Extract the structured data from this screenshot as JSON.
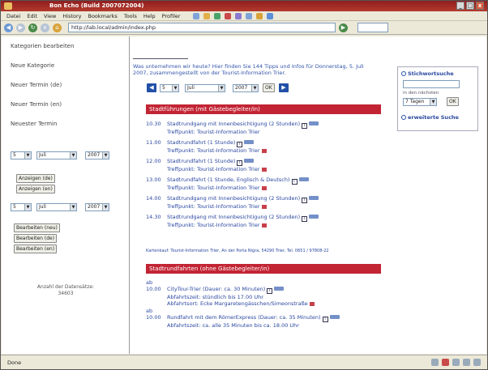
{
  "window": {
    "title": "Bon Echo (Build 2007072004)"
  },
  "menu": [
    "Datei",
    "Edit",
    "View",
    "History",
    "Bookmarks",
    "Tools",
    "Help",
    "Profiler"
  ],
  "toolbar": {
    "url": "http://lab.local/admin/index.php"
  },
  "sidebar": {
    "links": [
      "Kategorien bearbeiten",
      "Neue Kategorie",
      "Neuer Termin (de)",
      "Neuer Termin (en)",
      "Neuester Termin"
    ],
    "form1": {
      "day": "5",
      "month": "Juli",
      "year": "2007"
    },
    "buttons1": [
      "Anzeigen (de)",
      "Anzeigen (en)"
    ],
    "form2": {
      "day": "5",
      "month": "Juli",
      "year": "2007"
    },
    "buttons2": [
      "Bearbeiten (neu)",
      "Bearbeiten (de)",
      "Bearbeiten (en)"
    ],
    "counter_label": "Anzahl der Datensätze:",
    "counter_value": "34603"
  },
  "main": {
    "intro": "Was unternehmen wir heute? Hier finden Sie 144 Tipps und Infos für Donnerstag, 5. Juli 2007, zusammengestellt von der Tourist-Information Trier.",
    "nav": {
      "day": "5",
      "month": "Juli",
      "year": "2007",
      "ok": "OK"
    },
    "section1": "Stadtführungen (mit Gästebegleiter/in)",
    "entries1": [
      {
        "time": "10.30",
        "title": "Stadtrundgang mit Innenbesichtigung (2 Stunden)",
        "sub": "Treffpunkt: Tourist-Information Trier"
      },
      {
        "time": "11.00",
        "title": "Stadtrundfahrt (1 Stunde)",
        "sub": "Treffpunkt: Tourist-Information Trier"
      },
      {
        "time": "12.00",
        "title": "Stadtrundfahrt (1 Stunde)",
        "sub": "Treffpunkt: Tourist-Information Trier"
      },
      {
        "time": "13.00",
        "title": "Stadtrundfahrt (1 Stunde, Englisch & Deutsch)",
        "sub": "Treffpunkt: Tourist-Information Trier"
      },
      {
        "time": "14.00",
        "title": "Stadtrundgang mit Innenbesichtigung (2 Stunden)",
        "sub": "Treffpunkt: Tourist-Information Trier"
      },
      {
        "time": "14.30",
        "title": "Stadtrundgang mit Innenbesichtigung (2 Stunden)",
        "sub": "Treffpunkt: Tourist-Information Trier"
      }
    ],
    "footnote": "Kartenkauf: Tourist-Information Trier, An der Porta Nigra, 54290 Trier, Tel. 0651 / 97808-22",
    "section2": "Stadtrundfahrten (ohne Gästebegleiter/in)",
    "entries2": [
      {
        "time": "ab 10.00",
        "title": "CityTour-Trier (Dauer: ca. 30 Minuten)",
        "sub1": "Abfahrtszeit: stündlich bis 17.00 Uhr",
        "sub2": "Abfahrtsort: Ecke Margaretengässchen/Simeonstraße"
      },
      {
        "time": "ab 10.00",
        "title": "Rundfahrt mit dem RömerExpress (Dauer: ca. 35 Minuten)",
        "sub1": "Abfahrtszeit: ca. alle 35 Minuten bis ca. 18.00 Uhr"
      }
    ]
  },
  "right": {
    "search_title": "Stichwortsuche",
    "in_next": "in den nächsten",
    "range": "7 Tagen",
    "ok": "OK",
    "extended": "erweiterte Suche"
  },
  "status": {
    "text": "Done"
  }
}
